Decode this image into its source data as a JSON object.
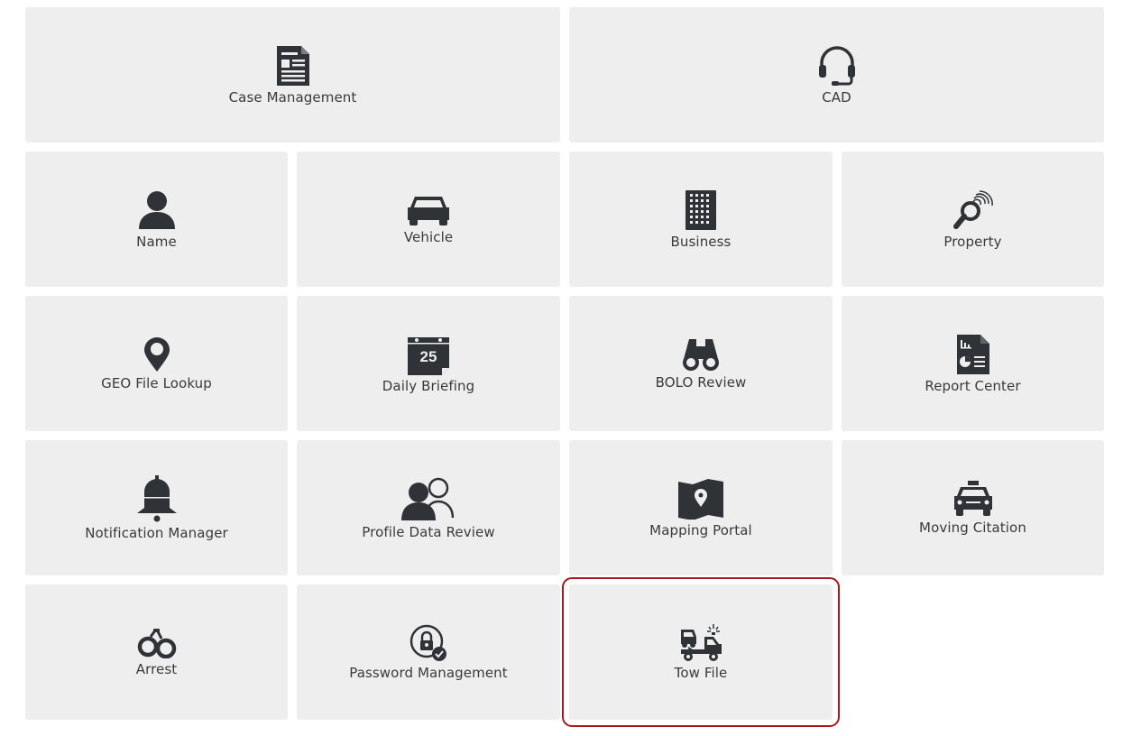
{
  "tiles": {
    "case_management": {
      "label": "Case Management",
      "icon": "document-icon"
    },
    "cad": {
      "label": "CAD",
      "icon": "headset-icon"
    },
    "name": {
      "label": "Name",
      "icon": "person-icon"
    },
    "vehicle": {
      "label": "Vehicle",
      "icon": "car-icon"
    },
    "business": {
      "label": "Business",
      "icon": "building-icon"
    },
    "property": {
      "label": "Property",
      "icon": "fingerprint-magnifier-icon"
    },
    "geo_file_lookup": {
      "label": "GEO File Lookup",
      "icon": "map-pin-icon"
    },
    "daily_briefing": {
      "label": "Daily Briefing",
      "icon": "calendar-icon",
      "calendar_day": "25"
    },
    "bolo_review": {
      "label": "BOLO Review",
      "icon": "binoculars-icon"
    },
    "report_center": {
      "label": "Report Center",
      "icon": "report-icon"
    },
    "notification_manager": {
      "label": "Notification Manager",
      "icon": "bell-icon"
    },
    "profile_data_review": {
      "label": "Profile Data Review",
      "icon": "users-icon"
    },
    "mapping_portal": {
      "label": "Mapping Portal",
      "icon": "map-icon"
    },
    "moving_citation": {
      "label": "Moving Citation",
      "icon": "police-car-icon"
    },
    "arrest": {
      "label": "Arrest",
      "icon": "handcuffs-icon"
    },
    "password_management": {
      "label": "Password Management",
      "icon": "lock-check-icon"
    },
    "tow_file": {
      "label": "Tow File",
      "icon": "tow-truck-icon",
      "selected": true
    }
  },
  "colors": {
    "tile_bg": "#eeeeee",
    "icon": "#2f3338",
    "label": "#3a3a3a",
    "selection": "#a41a1a"
  }
}
